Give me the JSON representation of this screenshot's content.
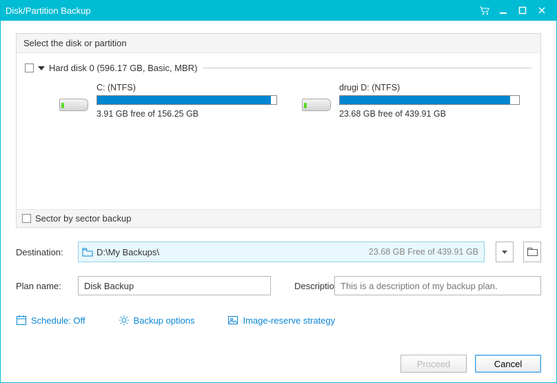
{
  "titlebar": {
    "title": "Disk/Partition Backup"
  },
  "panel": {
    "header": "Select the disk or partition",
    "disk": {
      "label": "Hard disk 0 (596.17 GB, Basic, MBR)",
      "partitions": [
        {
          "name": "C: (NTFS)",
          "free": "3.91 GB free of 156.25 GB",
          "fillPct": 97
        },
        {
          "name": "drugi D: (NTFS)",
          "free": "23.68 GB free of 439.91 GB",
          "fillPct": 95
        }
      ]
    },
    "sectorBySector": "Sector by sector backup"
  },
  "destination": {
    "label": "Destination:",
    "path": "D:\\My Backups\\",
    "free": "23.68 GB Free of 439.91 GB"
  },
  "plan": {
    "label": "Plan name:",
    "value": "Disk Backup",
    "descLabel": "Description:",
    "descPlaceholder": "This is a description of my backup plan."
  },
  "links": {
    "schedule": "Schedule: Off",
    "options": "Backup options",
    "reserve": "Image-reserve strategy"
  },
  "buttons": {
    "proceed": "Proceed",
    "cancel": "Cancel"
  }
}
